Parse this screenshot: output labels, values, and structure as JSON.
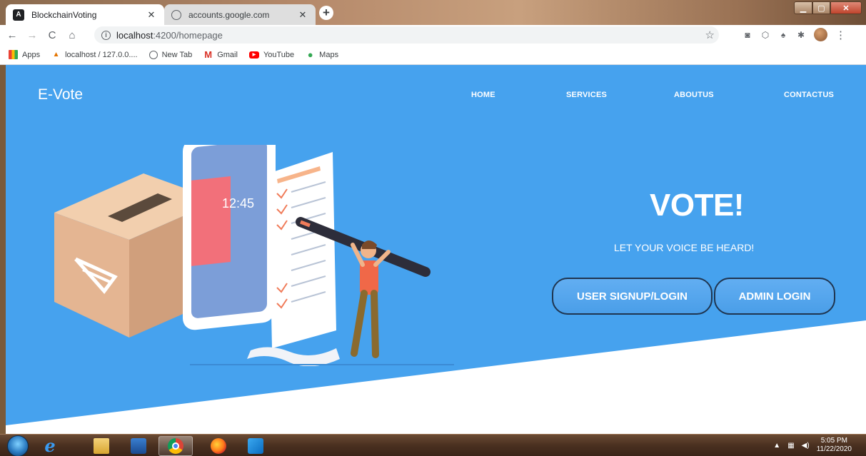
{
  "browser": {
    "tabs": [
      {
        "title": "BlockchainVoting",
        "favicon": "angular-icon",
        "active": true
      },
      {
        "title": "accounts.google.com",
        "favicon": "globe-icon",
        "active": false
      }
    ],
    "close_glyph": "✕",
    "new_tab_glyph": "+",
    "url_host": "localhost",
    "url_path": ":4200/homepage",
    "bookmarks": [
      {
        "label": "Apps",
        "icon": "apps-icon"
      },
      {
        "label": "localhost / 127.0.0....",
        "icon": "phpmyadmin-icon"
      },
      {
        "label": "New Tab",
        "icon": "globe-icon"
      },
      {
        "label": "Gmail",
        "icon": "gmail-icon"
      },
      {
        "label": "YouTube",
        "icon": "youtube-icon"
      },
      {
        "label": "Maps",
        "icon": "maps-icon"
      }
    ]
  },
  "page": {
    "brand": "E-Vote",
    "nav": [
      "HOME",
      "SERVICES",
      "ABOUTUS",
      "CONTACTUS"
    ],
    "headline": "VOTE!",
    "tagline": "LET YOUR VOICE BE HEARD!",
    "buttons": {
      "user_login": "USER SIGNUP/LOGIN",
      "admin_login": "ADMIN LOGIN"
    },
    "phone_time": "12:45",
    "colors": {
      "hero_blue": "#46a2ee",
      "button_border": "#1f3550"
    }
  },
  "taskbar": {
    "apps": [
      "internet-explorer-icon",
      "file-explorer-icon",
      "media-player-icon",
      "chrome-icon",
      "firefox-icon",
      "vscode-icon"
    ],
    "time": "5:05 PM",
    "date": "11/22/2020"
  }
}
